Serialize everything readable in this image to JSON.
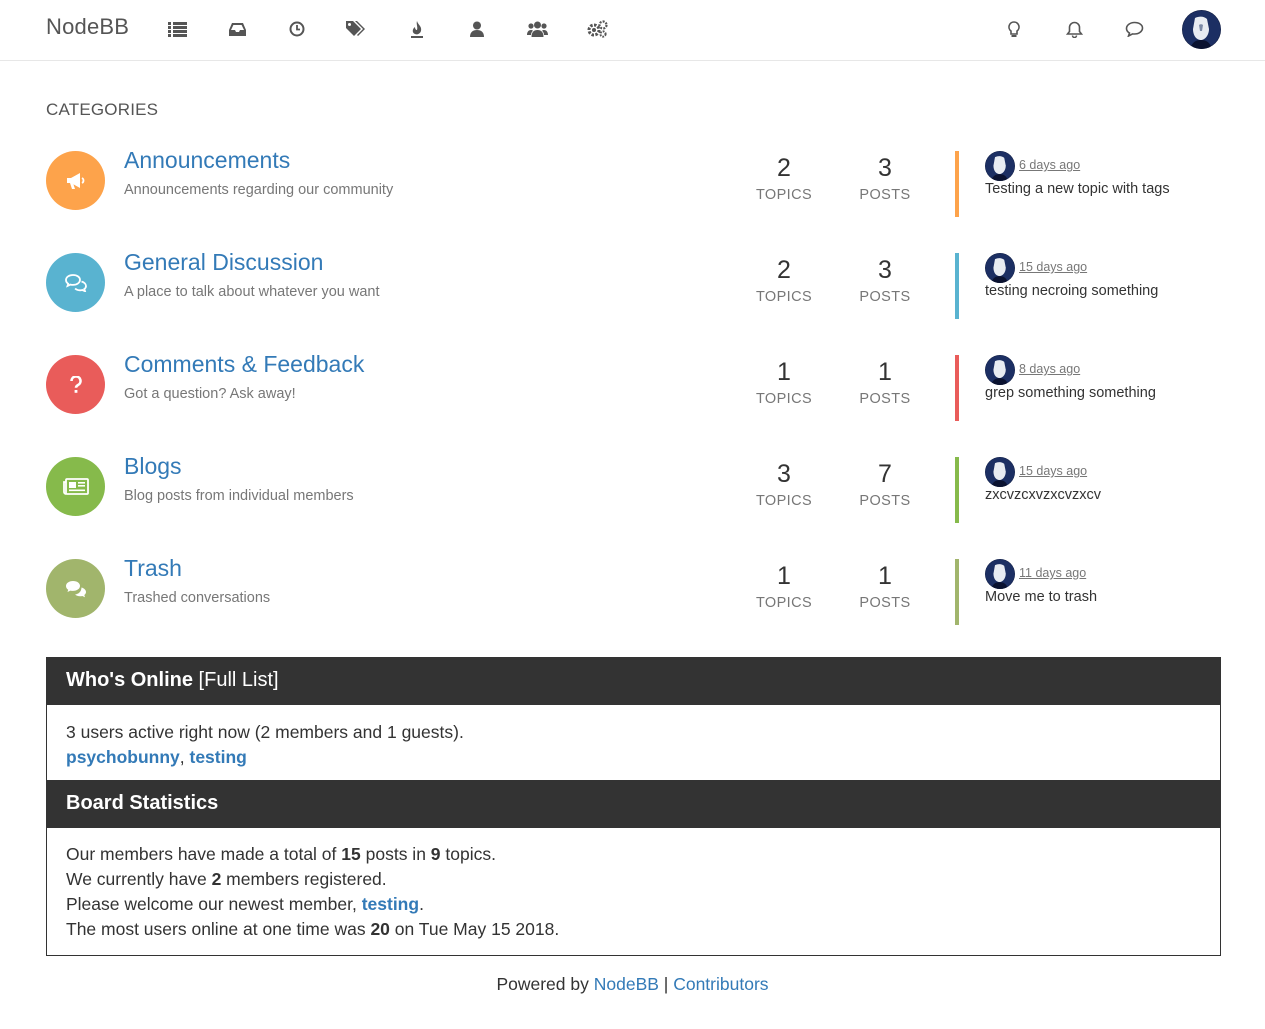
{
  "nav": {
    "brand": "NodeBB"
  },
  "categories_heading": "CATEGORIES",
  "categories": [
    {
      "title": "Announcements",
      "description": "Announcements regarding our community",
      "icon": "bullhorn-icon",
      "color": "#fda34b",
      "topics": "2",
      "topics_label": "TOPICS",
      "posts": "3",
      "posts_label": "POSTS",
      "teaser_time": "6 days ago",
      "teaser_text": "Testing a new topic with tags"
    },
    {
      "title": "General Discussion",
      "description": "A place to talk about whatever you want",
      "icon": "comments-icon",
      "color": "#59b3d0",
      "topics": "2",
      "topics_label": "TOPICS",
      "posts": "3",
      "posts_label": "POSTS",
      "teaser_time": "15 days ago",
      "teaser_text": "testing necroing something"
    },
    {
      "title": "Comments & Feedback",
      "description": "Got a question? Ask away!",
      "icon": "question-icon",
      "color": "#e95c5a",
      "topics": "1",
      "topics_label": "TOPICS",
      "posts": "1",
      "posts_label": "POSTS",
      "teaser_time": "8 days ago",
      "teaser_text": "grep something something"
    },
    {
      "title": "Blogs",
      "description": "Blog posts from individual members",
      "icon": "newspaper-icon",
      "color": "#86ba4b",
      "topics": "3",
      "topics_label": "TOPICS",
      "posts": "7",
      "posts_label": "POSTS",
      "teaser_time": "15 days ago",
      "teaser_text": "zxcvzcxvzxcvzxcv"
    },
    {
      "title": "Trash",
      "description": "Trashed conversations",
      "icon": "comments-icon",
      "color": "#a1b56c",
      "topics": "1",
      "topics_label": "TOPICS",
      "posts": "1",
      "posts_label": "POSTS",
      "teaser_time": "11 days ago",
      "teaser_text": "Move me to trash"
    }
  ],
  "online": {
    "title": "Who's Online",
    "full_list": "[Full List]",
    "summary": "3 users active right now (2 members and 1 guests).",
    "users": [
      "psychobunny",
      "testing"
    ],
    "separator": ", "
  },
  "stats": {
    "title": "Board Statistics",
    "line1_a": "Our members have made a total of ",
    "posts_total": "15",
    "line1_b": " posts in ",
    "topics_total": "9",
    "line1_c": " topics.",
    "line2_a": "We currently have ",
    "members_total": "2",
    "line2_b": " members registered.",
    "line3_a": "Please welcome our newest member, ",
    "newest_member": "testing",
    "line3_b": ".",
    "line4_a": "The most users online at one time was ",
    "max_online": "20",
    "line4_b": " on Tue May 15 2018."
  },
  "footer": {
    "powered_by": "Powered by ",
    "nodebb": "NodeBB",
    "sep": " | ",
    "contributors": "Contributors"
  },
  "colors": {
    "link": "#337ab7",
    "panel_header": "#333333"
  }
}
